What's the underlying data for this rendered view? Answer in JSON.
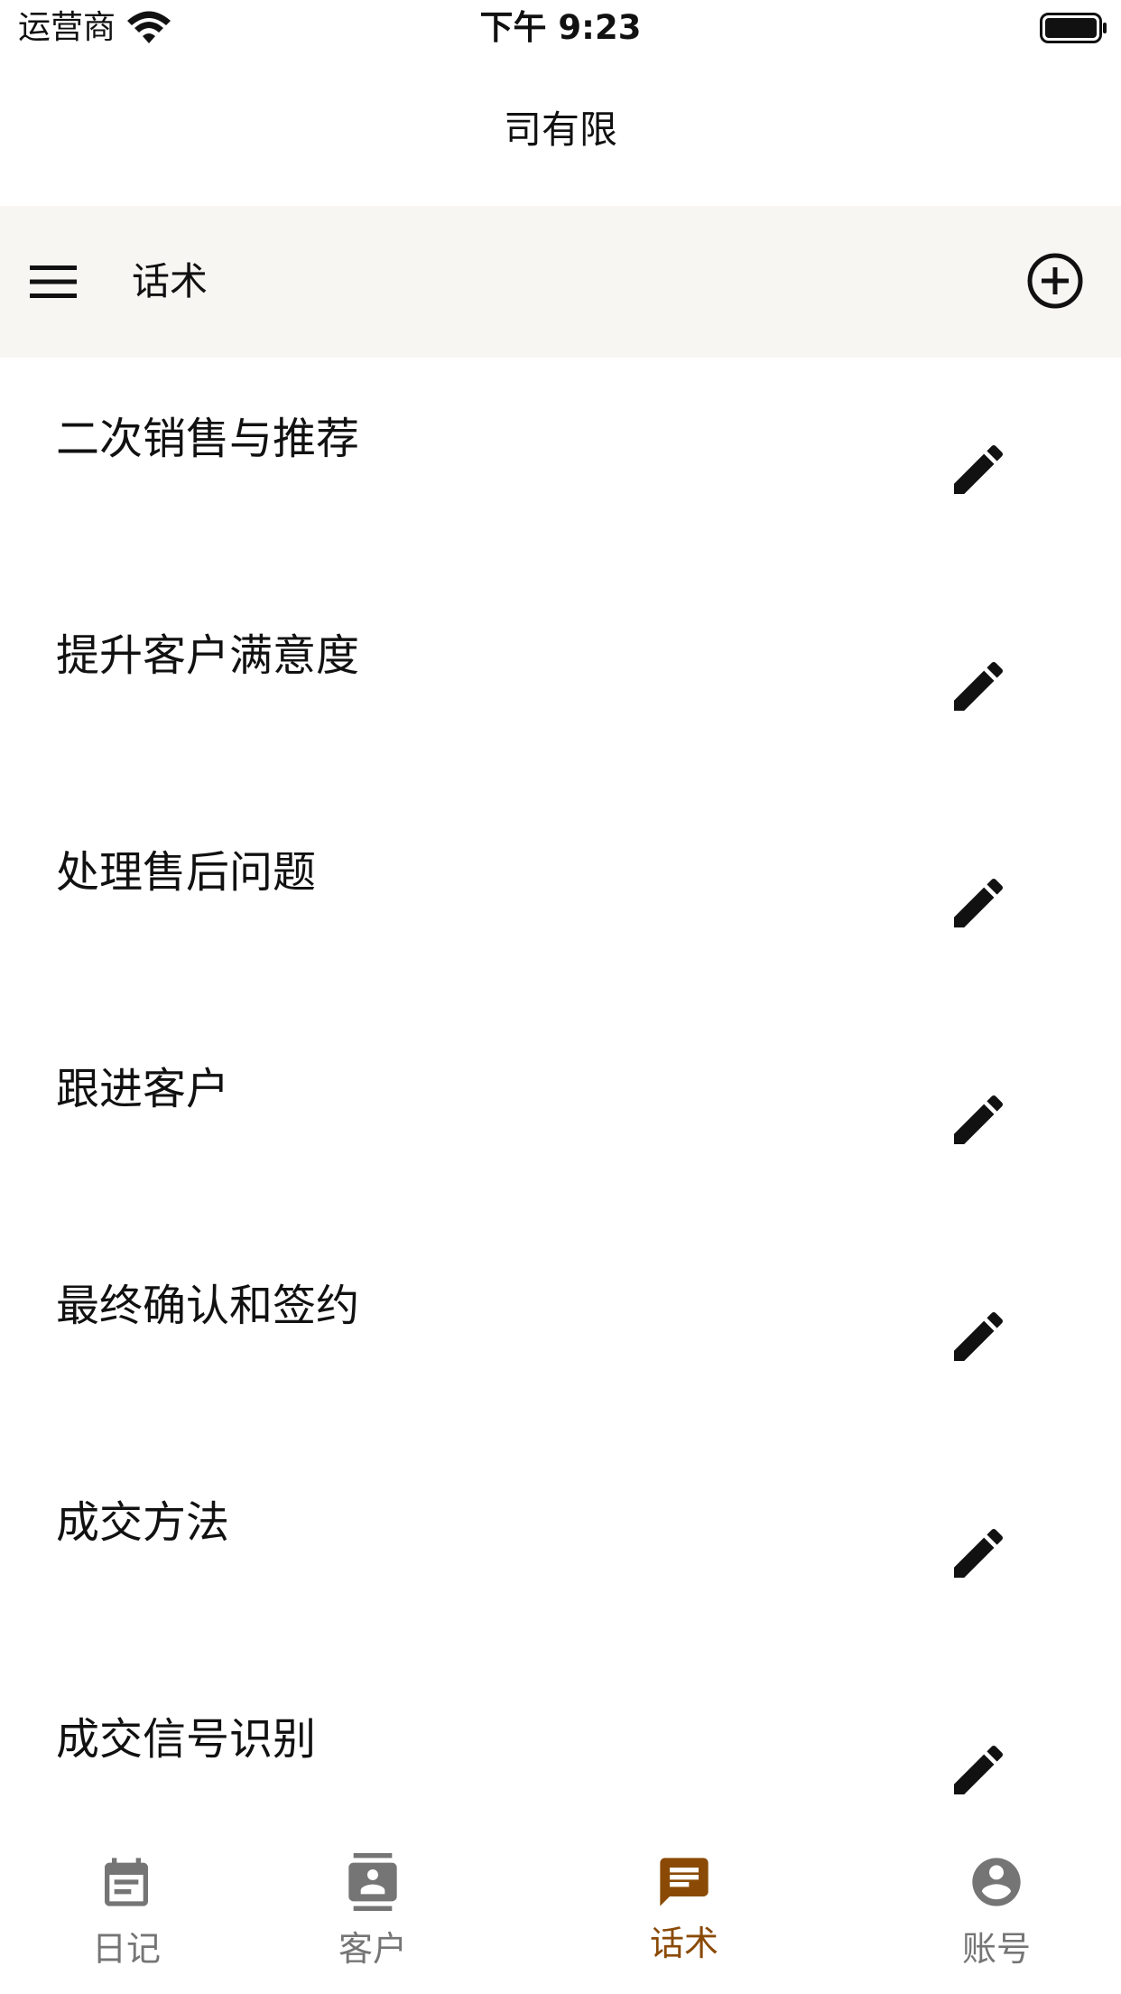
{
  "status_bar": {
    "carrier": "运营商",
    "time": "下午 9:23"
  },
  "header": {
    "title": "司有限"
  },
  "toolbar": {
    "title": "话术"
  },
  "list": {
    "items": [
      {
        "label": "二次销售与推荐"
      },
      {
        "label": "提升客户满意度"
      },
      {
        "label": "处理售后问题"
      },
      {
        "label": "跟进客户"
      },
      {
        "label": "最终确认和签约"
      },
      {
        "label": "成交方法"
      },
      {
        "label": "成交信号识别"
      }
    ]
  },
  "tab_bar": {
    "tabs": [
      {
        "label": "日记",
        "icon": "calendar-icon",
        "active": false
      },
      {
        "label": "客户",
        "icon": "contact-card-icon",
        "active": false
      },
      {
        "label": "话术",
        "icon": "message-icon",
        "active": true
      },
      {
        "label": "账号",
        "icon": "account-circle-icon",
        "active": false
      }
    ]
  },
  "colors": {
    "accent": "#8a4a05",
    "inactive": "#757575",
    "toolbar_bg": "#f8f6f3",
    "text": "#111111"
  }
}
